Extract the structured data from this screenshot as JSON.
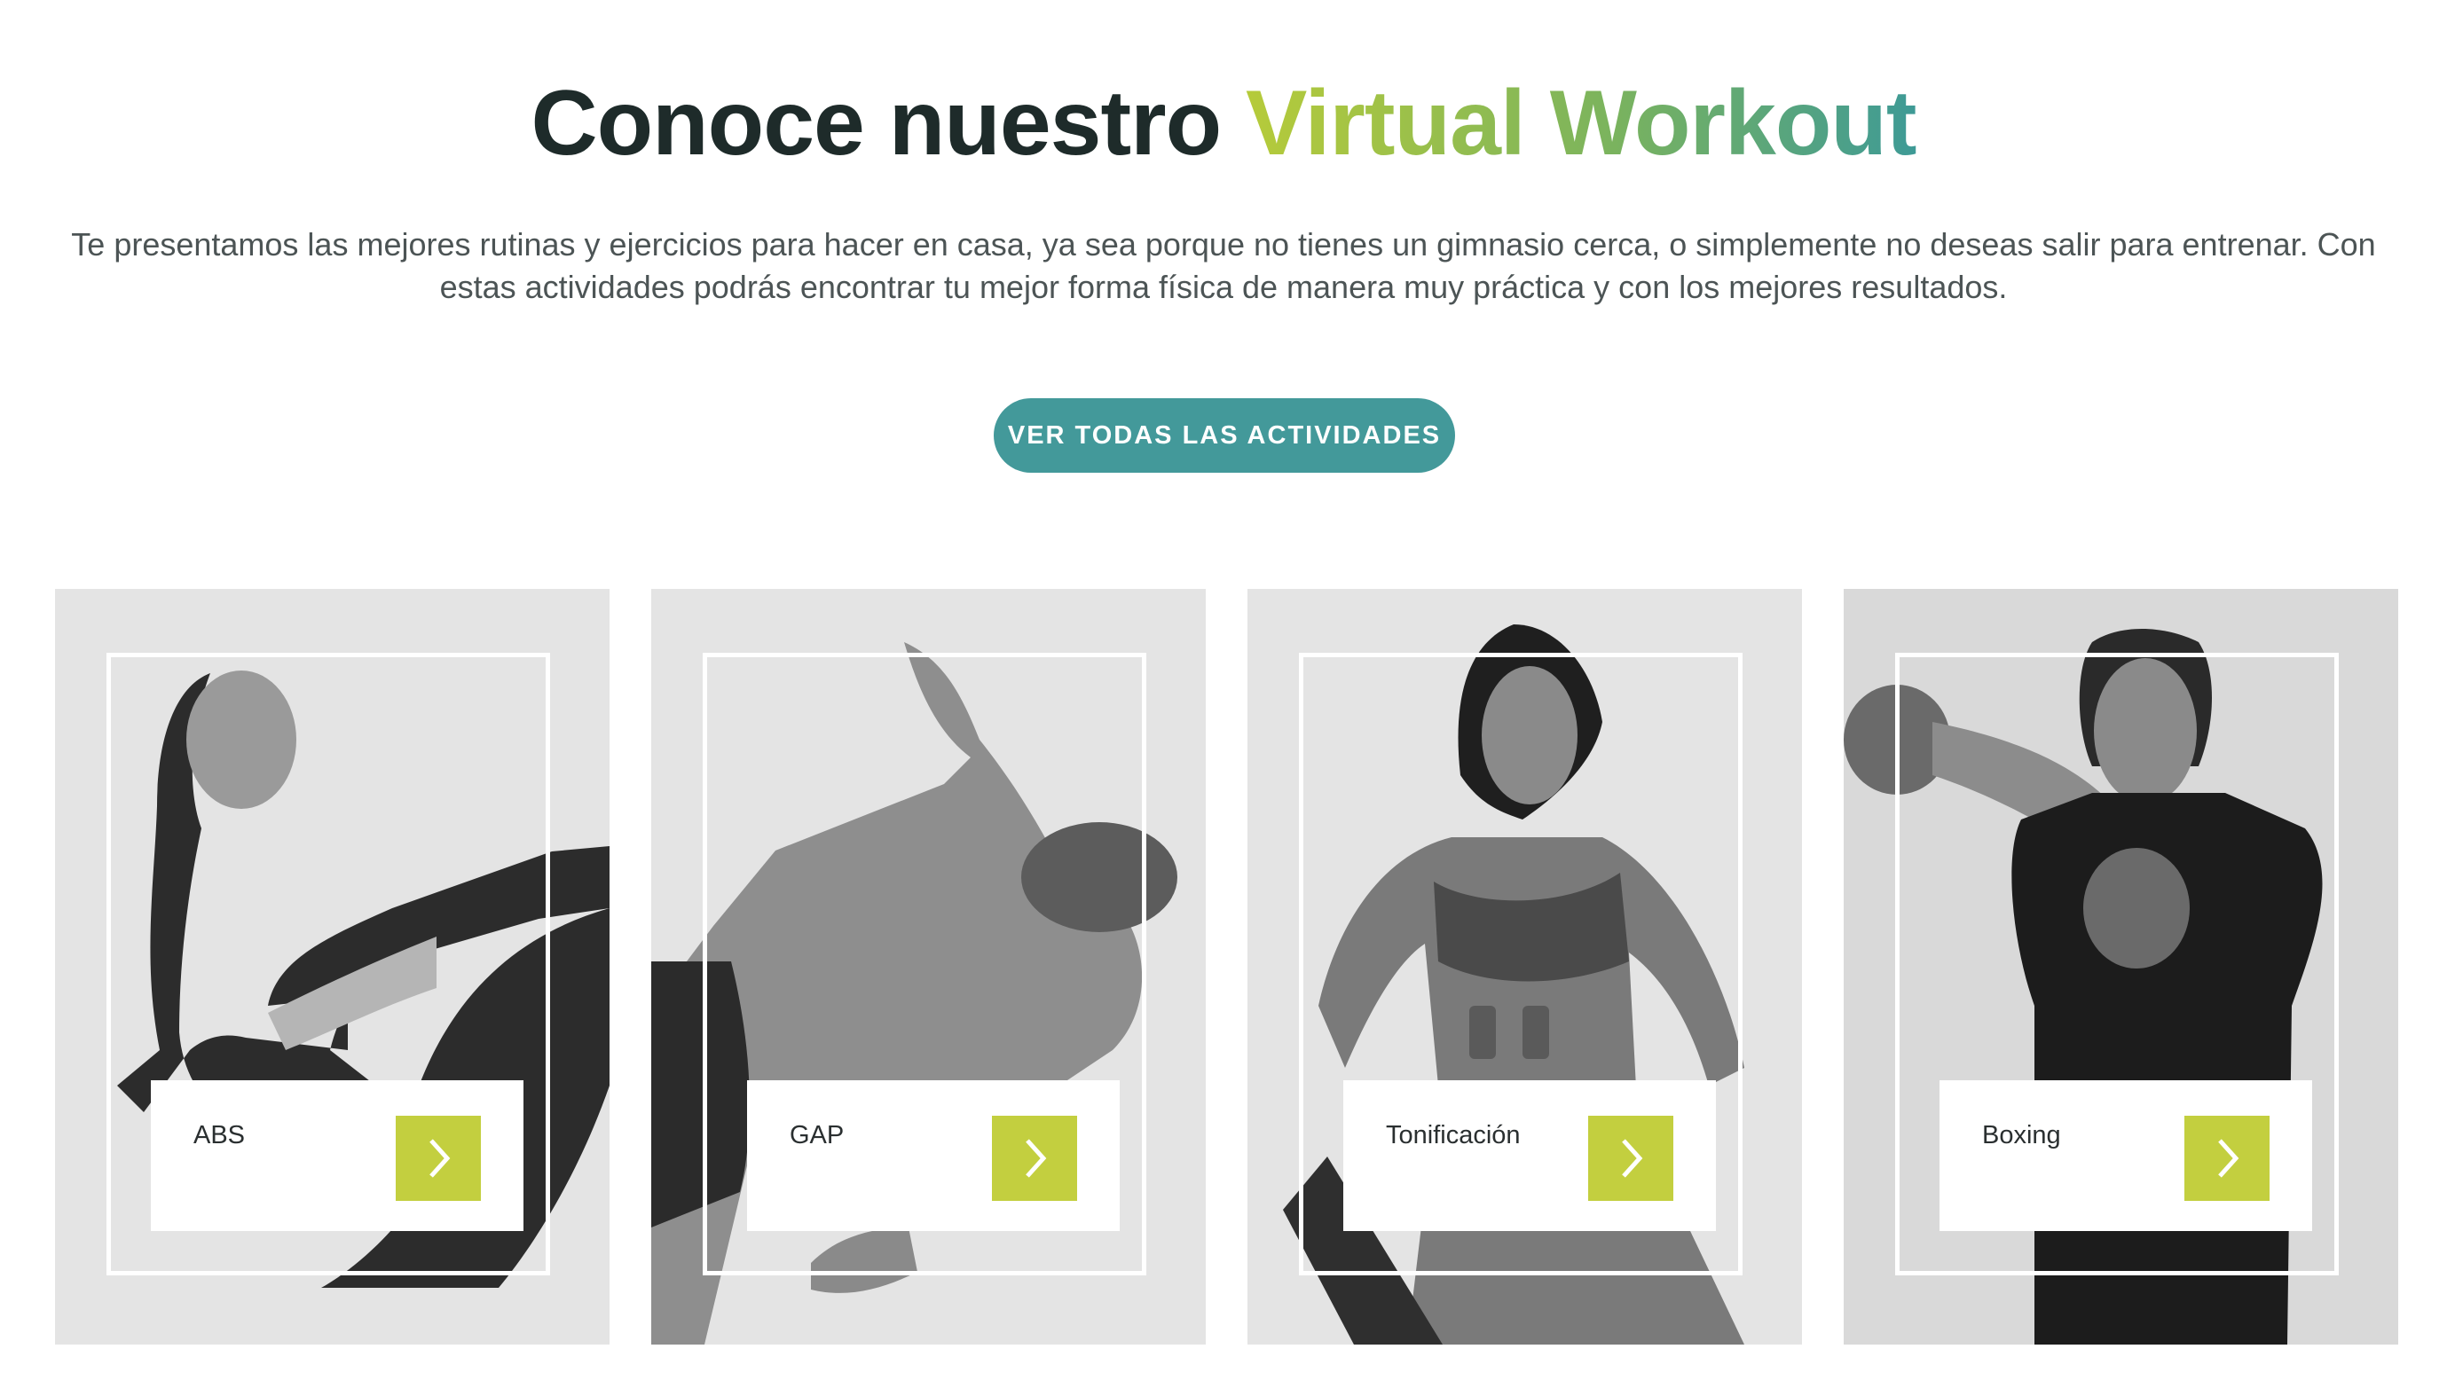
{
  "header": {
    "title_prefix": "Conoce nuestro",
    "title_accent": "Virtual Workout",
    "description": "Te presentamos las mejores rutinas y ejercicios para hacer en casa, ya sea porque no tienes un gimnasio cerca, o simplemente no deseas salir para entrenar. Con estas actividades podrás encontrar tu mejor forma física de manera muy práctica y con los mejores resultados.",
    "cta_label": "VER TODAS LAS ACTIVIDADES"
  },
  "colors": {
    "title": "#1e2b2a",
    "accent_gradient": [
      "#b6cb3a",
      "#7ab35e",
      "#3e9a96"
    ],
    "cta_background": "#43999a",
    "arrow_button": "#c3cf3f",
    "card_background": "#e4e4e4"
  },
  "cards": [
    {
      "label": "ABS",
      "icon": "chevron-right-icon"
    },
    {
      "label": "GAP",
      "icon": "chevron-right-icon"
    },
    {
      "label": "Tonificación",
      "icon": "chevron-right-icon"
    },
    {
      "label": "Boxing",
      "icon": "chevron-right-icon"
    }
  ]
}
